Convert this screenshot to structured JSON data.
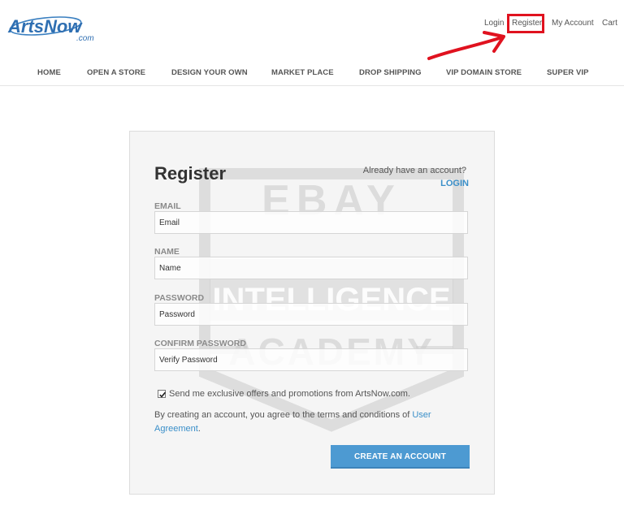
{
  "header": {
    "logo_main": "ArtsNow",
    "logo_sub": ".com",
    "links": {
      "login": "Login",
      "register": "Register",
      "my_account": "My Account",
      "cart": "Cart"
    }
  },
  "nav": {
    "items": [
      "HOME",
      "OPEN A STORE",
      "DESIGN YOUR OWN",
      "MARKET PLACE",
      "DROP SHIPPING",
      "VIP DOMAIN STORE",
      "SUPER VIP"
    ]
  },
  "watermark": {
    "line1": "EBAY",
    "line2": "INTELLIGENCE",
    "line3": "ACADEMY"
  },
  "form": {
    "title": "Register",
    "already_text": "Already have an account?",
    "login_link": "LOGIN",
    "email_label": "EMAIL",
    "email_placeholder": "Email",
    "name_label": "NAME",
    "name_placeholder": "Name",
    "password_label": "PASSWORD",
    "password_placeholder": "Password",
    "confirm_label": "CONFIRM PASSWORD",
    "confirm_placeholder": "Verify Password",
    "offers_text": "Send me exclusive offers and promotions from ArtsNow.com.",
    "offers_checked": true,
    "agree_text": "By creating an account, you agree to the terms and conditions of ",
    "agree_link": "User Agreement",
    "agree_end": ".",
    "submit_label": "CREATE AN ACCOUNT"
  },
  "colors": {
    "accent": "#3a8fc9",
    "button": "#4d9ad2",
    "highlight": "#e0121f"
  }
}
